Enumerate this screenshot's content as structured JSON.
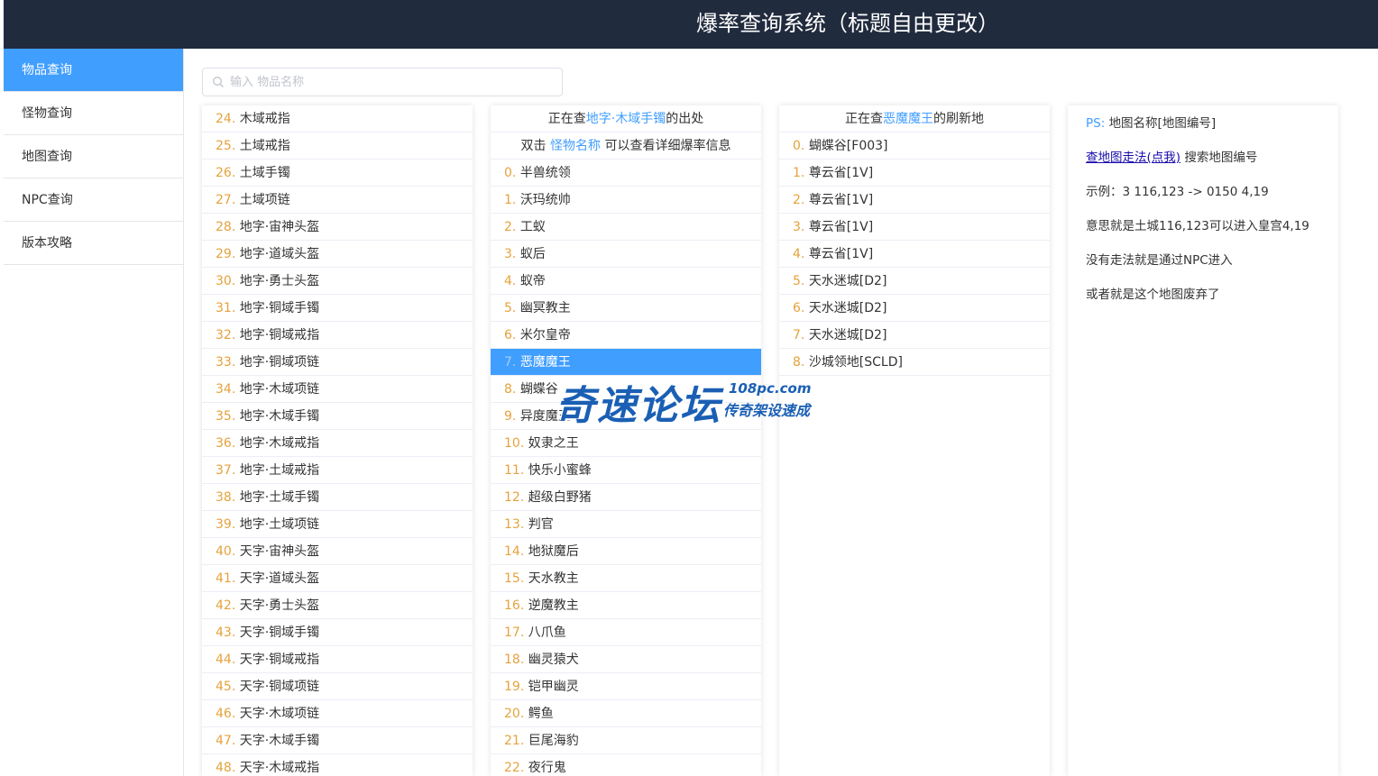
{
  "header": {
    "title": "爆率查询系统（标题自由更改）"
  },
  "sidebar": {
    "items": [
      {
        "label": "物品查询",
        "active": true
      },
      {
        "label": "怪物查询"
      },
      {
        "label": "地图查询"
      },
      {
        "label": "NPC查询"
      },
      {
        "label": "版本攻略"
      }
    ]
  },
  "search": {
    "placeholder": "输入 物品名称",
    "value": ""
  },
  "items": {
    "selected": 35,
    "rows": [
      {
        "idx": "24.",
        "name": "木域戒指"
      },
      {
        "idx": "25.",
        "name": "土域戒指"
      },
      {
        "idx": "26.",
        "name": "土域手镯"
      },
      {
        "idx": "27.",
        "name": "土域项链"
      },
      {
        "idx": "28.",
        "name": "地字·宙神头盔"
      },
      {
        "idx": "29.",
        "name": "地字·道域头盔"
      },
      {
        "idx": "30.",
        "name": "地字·勇士头盔"
      },
      {
        "idx": "31.",
        "name": "地字·铜域手镯"
      },
      {
        "idx": "32.",
        "name": "地字·铜域戒指"
      },
      {
        "idx": "33.",
        "name": "地字·铜域项链"
      },
      {
        "idx": "34.",
        "name": "地字·木域项链"
      },
      {
        "idx": "35.",
        "name": "地字·木域手镯"
      },
      {
        "idx": "36.",
        "name": "地字·木域戒指"
      },
      {
        "idx": "37.",
        "name": "地字·土域戒指"
      },
      {
        "idx": "38.",
        "name": "地字·土域手镯"
      },
      {
        "idx": "39.",
        "name": "地字·土域项链"
      },
      {
        "idx": "40.",
        "name": "天字·宙神头盔"
      },
      {
        "idx": "41.",
        "name": "天字·道域头盔"
      },
      {
        "idx": "42.",
        "name": "天字·勇士头盔"
      },
      {
        "idx": "43.",
        "name": "天字·铜域手镯"
      },
      {
        "idx": "44.",
        "name": "天字·铜域戒指"
      },
      {
        "idx": "45.",
        "name": "天字·铜域项链"
      },
      {
        "idx": "46.",
        "name": "天字·木域项链"
      },
      {
        "idx": "47.",
        "name": "天字·木域手镯"
      },
      {
        "idx": "48.",
        "name": "天字·木域戒指"
      }
    ]
  },
  "monsters": {
    "header_prefix": "正在查",
    "header_target": "地字·木域手镯",
    "header_suffix": "的出处",
    "hint_prefix": "双击",
    "hint_link": "怪物名称",
    "hint_suffix": "可以查看详细爆率信息",
    "selected": 7,
    "rows": [
      {
        "idx": "0.",
        "name": "半兽统领"
      },
      {
        "idx": "1.",
        "name": "沃玛统帅"
      },
      {
        "idx": "2.",
        "name": "工蚁"
      },
      {
        "idx": "3.",
        "name": "蚁后"
      },
      {
        "idx": "4.",
        "name": "蚁帝"
      },
      {
        "idx": "5.",
        "name": "幽冥教主"
      },
      {
        "idx": "6.",
        "name": "米尔皇帝"
      },
      {
        "idx": "7.",
        "name": "恶魔魔王"
      },
      {
        "idx": "8.",
        "name": "蝴蝶谷"
      },
      {
        "idx": "9.",
        "name": "异度魔王"
      },
      {
        "idx": "10.",
        "name": "奴隶之王"
      },
      {
        "idx": "11.",
        "name": "快乐小蜜蜂"
      },
      {
        "idx": "12.",
        "name": "超级白野猪"
      },
      {
        "idx": "13.",
        "name": "判官"
      },
      {
        "idx": "14.",
        "name": "地狱魔后"
      },
      {
        "idx": "15.",
        "name": "天水教主"
      },
      {
        "idx": "16.",
        "name": "逆魔教主"
      },
      {
        "idx": "17.",
        "name": "八爪鱼"
      },
      {
        "idx": "18.",
        "name": "幽灵猿犬"
      },
      {
        "idx": "19.",
        "name": "铠甲幽灵"
      },
      {
        "idx": "20.",
        "name": "鳄鱼"
      },
      {
        "idx": "21.",
        "name": "巨尾海豹"
      },
      {
        "idx": "22.",
        "name": "夜行鬼"
      }
    ]
  },
  "maps": {
    "header_prefix": "正在查",
    "header_target": "恶魔魔王",
    "header_suffix": "的刷新地",
    "rows": [
      {
        "idx": "0.",
        "name": "蝴蝶谷[F003]"
      },
      {
        "idx": "1.",
        "name": "尊云省[1V]"
      },
      {
        "idx": "2.",
        "name": "尊云省[1V]"
      },
      {
        "idx": "3.",
        "name": "尊云省[1V]"
      },
      {
        "idx": "4.",
        "name": "尊云省[1V]"
      },
      {
        "idx": "5.",
        "name": "天水迷城[D2]"
      },
      {
        "idx": "6.",
        "name": "天水迷城[D2]"
      },
      {
        "idx": "7.",
        "name": "天水迷城[D2]"
      },
      {
        "idx": "8.",
        "name": "沙城领地[SCLD]"
      }
    ]
  },
  "info": {
    "ps_label": "PS:",
    "ps_text": "地图名称[地图编号]",
    "link_text": "查地图走法(点我)",
    "link_suffix": "搜索地图编号",
    "example": "示例：3 116,123 -> 0150 4,19",
    "meaning": "意思就是土城116,123可以进入皇宫4,19",
    "no_route": "没有走法就是通过NPC进入",
    "abandoned": "或者就是这个地图废弃了"
  },
  "watermark": {
    "main": "奇速论坛",
    "url": "108pc.com",
    "slogan": "传奇架设速成"
  },
  "colors": {
    "header_bg": "#212b3e",
    "accent": "#409eff",
    "index": "#e6a23c"
  }
}
